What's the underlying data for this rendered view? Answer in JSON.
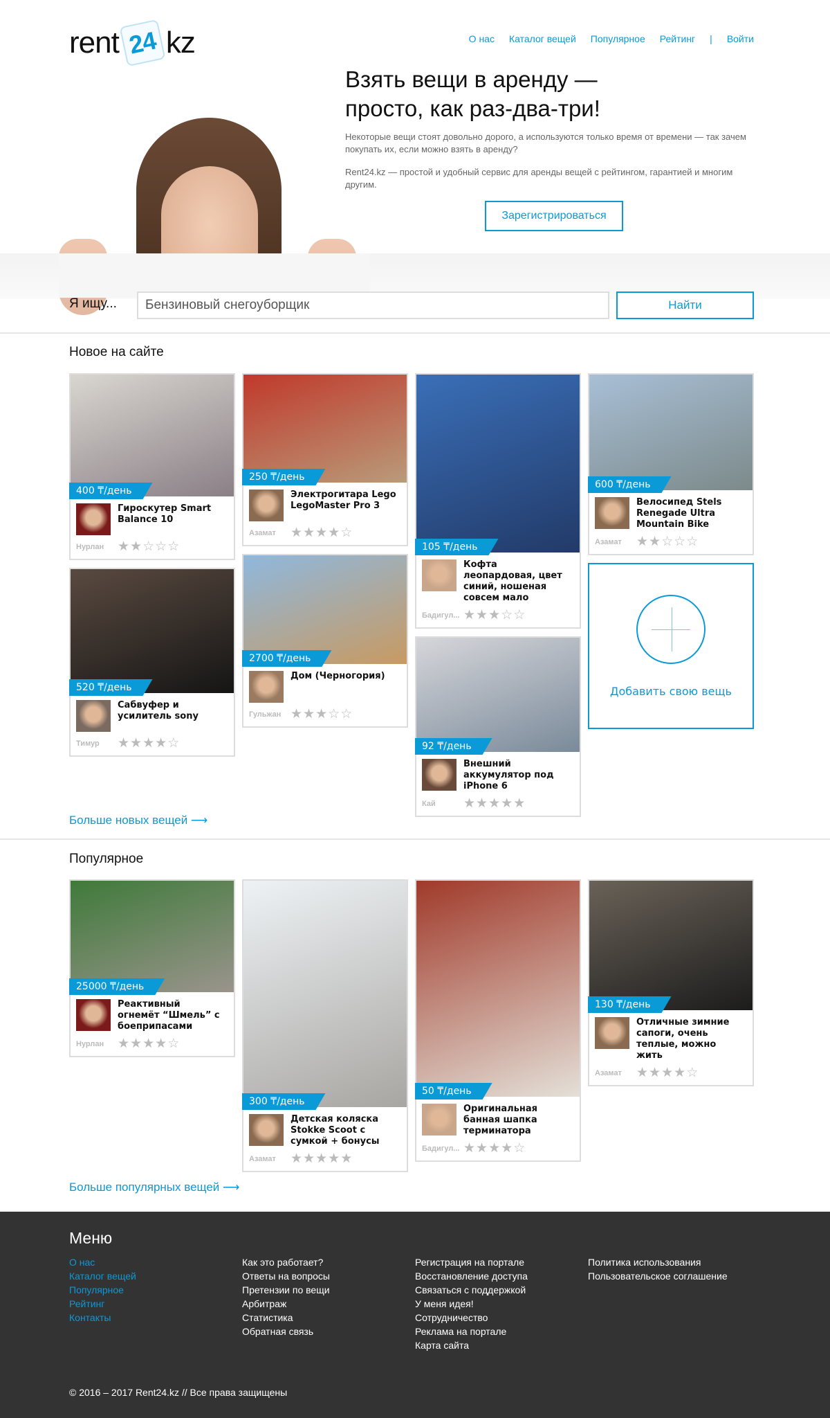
{
  "header": {
    "logo_left": "rent",
    "logo_badge": "24",
    "logo_right": "kz",
    "nav": [
      "О нас",
      "Каталог вещей",
      "Популярное",
      "Рейтинг",
      "|",
      "Войти"
    ]
  },
  "hero": {
    "title_1": "Взять вещи в аренду —",
    "title_2": "просто, как раз-два-три!",
    "p1": "Некоторые вещи стоят довольно дорого, а используются только время от времени — так зачем покупать их, если можно взять в аренду?",
    "p2": "Rent24.kz — простой и удобный сервис для аренды вещей с рейтингом, гарантией и многим другим.",
    "register": "Зарегистрироваться"
  },
  "search": {
    "label": "Я ищу...",
    "value": "Бензиновый снегоуборщик",
    "button": "Найти"
  },
  "accent": "#0a9ad7",
  "new_section": {
    "title": "Новое на сайте",
    "more": "Больше новых вещей",
    "add_label": "Добавить свою вещь",
    "columns": [
      [
        {
          "price": "400 ₸/день",
          "title": "Гироскутер Smart Balance 10",
          "owner": "Нурлан",
          "rating": 2,
          "img": [
            "#d9d6d0",
            "#8a7f86"
          ],
          "av": "#7a1a1a"
        },
        {
          "price": "520 ₸/день",
          "title": "Сабвуфер и усилитель sony",
          "owner": "Тимур",
          "rating": 4,
          "img": [
            "#5a4a40",
            "#151515"
          ],
          "av": "#7a6a60"
        }
      ],
      [
        {
          "price": "250 ₸/день",
          "title": "Электрогитара Lego LegoMaster Pro 3",
          "owner": "Азамат",
          "rating": 4,
          "img": [
            "#c0392b",
            "#b99b7a"
          ],
          "av": "#8a6a50"
        },
        {
          "price": "2700 ₸/день",
          "title": "Дом (Черногория)",
          "owner": "Гульжан",
          "rating": 3,
          "img": [
            "#8fb8de",
            "#c89a62"
          ],
          "av": "#9a7a60"
        }
      ],
      [
        {
          "price": "105 ₸/день",
          "title": "Кофта леопардовая, цвет синий, ношеная совсем мало",
          "owner": "Бадигул...",
          "rating": 3,
          "img": [
            "#3a6fb8",
            "#223a68"
          ],
          "av": "#c9a58a"
        },
        {
          "price": "92 ₸/день",
          "title": "Внешний аккумулятор под iPhone 6",
          "owner": "Кай",
          "rating": 5,
          "img": [
            "#d6d6da",
            "#7a8a9a"
          ],
          "av": "#6a4a3a"
        }
      ],
      [
        {
          "price": "600 ₸/день",
          "title": "Велосипед Stels Renegade Ultra Mountain Bike",
          "owner": "Азамат",
          "rating": 2,
          "img": [
            "#a8bfd6",
            "#7c8a8a"
          ],
          "av": "#8a6a50"
        }
      ]
    ]
  },
  "popular_section": {
    "title": "Популярное",
    "more": "Больше популярных вещей",
    "columns": [
      [
        {
          "price": "25000 ₸/день",
          "title": "Реактивный огнемёт “Шмель” с боеприпасами",
          "owner": "Нурлан",
          "rating": 4,
          "img": [
            "#3f7a3a",
            "#9a948c"
          ],
          "av": "#7a1a1a"
        }
      ],
      [
        {
          "price": "300 ₸/день",
          "title": "Детская коляска Stokke Scoot с сумкой + бонусы",
          "owner": "Азамат",
          "rating": 5,
          "img": [
            "#eef2f5",
            "#a8a6a2"
          ],
          "av": "#8a6a50"
        }
      ],
      [
        {
          "price": "50 ₸/день",
          "title": "Оригинальная банная шапка терминатора",
          "owner": "Бадигул...",
          "rating": 4,
          "img": [
            "#a03a2a",
            "#e4e0d8"
          ],
          "av": "#c9a58a"
        }
      ],
      [
        {
          "price": "130 ₸/день",
          "title": "Отличные зимние сапоги, очень теплые, можно жить",
          "owner": "Азамат",
          "rating": 4,
          "img": [
            "#6a6258",
            "#1c1c1c"
          ],
          "av": "#8a6a50"
        }
      ]
    ]
  },
  "footer": {
    "title": "Меню",
    "col1": [
      "О нас",
      "Каталог вещей",
      "Популярное",
      "Рейтинг",
      "Контакты"
    ],
    "col2": [
      "Как это работает?",
      "Ответы на вопросы",
      "Претензии по вещи",
      "Арбитраж",
      "Статистика",
      "Обратная связь"
    ],
    "col3": [
      "Регистрация на портале",
      "Восстановление доступа",
      "Связаться с поддержкой",
      "У меня идея!",
      "Сотрудничество",
      "Реклама на портале",
      "Карта сайта"
    ],
    "col4": [
      "Политика использования",
      "Пользовательское соглашение"
    ],
    "copyright": "© 2016 – 2017 Rent24.kz // Все права защищены"
  }
}
